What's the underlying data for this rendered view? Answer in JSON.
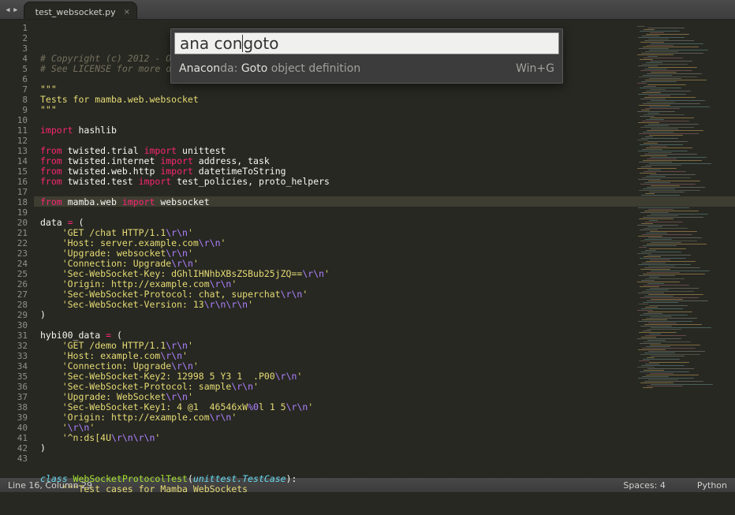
{
  "titlebar": {
    "nav_prev": "◂",
    "nav_next": "▸"
  },
  "tab": {
    "filename": "test_websocket.py",
    "close_glyph": "×"
  },
  "palette": {
    "input_before_cursor": "ana con",
    "input_after_cursor": "goto",
    "result_highlight": "Anacon",
    "result_mid": "da: ",
    "result_highlight2": "Goto",
    "result_tail": " object definition",
    "shortcut": "Win+G"
  },
  "gutter": {
    "start": 1,
    "end": 43
  },
  "code_lines": [
    {
      "t": "plain",
      "text": ""
    },
    {
      "t": "comment",
      "text": "# Copyright (c) 2012 - Osca"
    },
    {
      "t": "comment",
      "text": "# See LICENSE for more deta"
    },
    {
      "t": "plain",
      "text": ""
    },
    {
      "t": "str",
      "text": "\"\"\""
    },
    {
      "t": "str",
      "text": "Tests for mamba.web.websocket"
    },
    {
      "t": "str",
      "text": "\"\"\""
    },
    {
      "t": "plain",
      "text": ""
    },
    {
      "t": "import1",
      "kw": "import ",
      "mod": "hashlib"
    },
    {
      "t": "plain",
      "text": ""
    },
    {
      "t": "import2",
      "kw1": "from ",
      "mod": "twisted.trial",
      "kw2": " import ",
      "names": "unittest"
    },
    {
      "t": "import2",
      "kw1": "from ",
      "mod": "twisted.internet",
      "kw2": " import ",
      "names": "address, task"
    },
    {
      "t": "import2",
      "kw1": "from ",
      "mod": "twisted.web.http",
      "kw2": " import ",
      "names": "datetimeToString"
    },
    {
      "t": "import2",
      "kw1": "from ",
      "mod": "twisted.test",
      "kw2": " import ",
      "names": "test_policies, proto_helpers"
    },
    {
      "t": "plain",
      "text": ""
    },
    {
      "t": "import2",
      "kw1": "from ",
      "mod": "mamba.web",
      "kw2": " import ",
      "names": "websocket"
    },
    {
      "t": "plain",
      "text": ""
    },
    {
      "t": "assign",
      "lhs": "data ",
      "op": "=",
      "rhs": " ("
    },
    {
      "t": "strline",
      "s": "    'GET /chat HTTP/1.1",
      "e": "\\r\\n",
      "tail": "'"
    },
    {
      "t": "strline",
      "s": "    'Host: server.example.com",
      "e": "\\r\\n",
      "tail": "'"
    },
    {
      "t": "strline",
      "s": "    'Upgrade: websocket",
      "e": "\\r\\n",
      "tail": "'"
    },
    {
      "t": "strline",
      "s": "    'Connection: Upgrade",
      "e": "\\r\\n",
      "tail": "'"
    },
    {
      "t": "strline",
      "s": "    'Sec-WebSocket-Key: dGhlIHNhbXBsZSBub25jZQ==",
      "e": "\\r\\n",
      "tail": "'"
    },
    {
      "t": "strline",
      "s": "    'Origin: http://example.com",
      "e": "\\r\\n",
      "tail": "'"
    },
    {
      "t": "strline",
      "s": "    'Sec-WebSocket-Protocol: chat, superchat",
      "e": "\\r\\n",
      "tail": "'"
    },
    {
      "t": "strline",
      "s": "    'Sec-WebSocket-Version: 13",
      "e": "\\r\\n\\r\\n",
      "tail": "'"
    },
    {
      "t": "pl",
      "text": ")"
    },
    {
      "t": "plain",
      "text": ""
    },
    {
      "t": "assign",
      "lhs": "hybi00_data ",
      "op": "=",
      "rhs": " ("
    },
    {
      "t": "strline",
      "s": "    'GET /demo HTTP/1.1",
      "e": "\\r\\n",
      "tail": "'"
    },
    {
      "t": "strline",
      "s": "    'Host: example.com",
      "e": "\\r\\n",
      "tail": "'"
    },
    {
      "t": "strline",
      "s": "    'Connection: Upgrade",
      "e": "\\r\\n",
      "tail": "'"
    },
    {
      "t": "strline",
      "s": "    'Sec-WebSocket-Key2: 12998 5 Y3 1  .P00",
      "e": "\\r\\n",
      "tail": "'"
    },
    {
      "t": "strline",
      "s": "    'Sec-WebSocket-Protocol: sample",
      "e": "\\r\\n",
      "tail": "'"
    },
    {
      "t": "strline",
      "s": "    'Upgrade: WebSocket",
      "e": "\\r\\n",
      "tail": "'"
    },
    {
      "t": "strline2",
      "s": "    'Sec-WebSocket-Key1: 4 @1  46546xW",
      "e1": "%0",
      "s2": "l 1 5",
      "e2": "\\r\\n",
      "tail": "'"
    },
    {
      "t": "strline",
      "s": "    'Origin: http://example.com",
      "e": "\\r\\n",
      "tail": "'"
    },
    {
      "t": "strline",
      "s": "    '",
      "e": "\\r\\n",
      "tail": "'"
    },
    {
      "t": "strline",
      "s": "    '^n:ds[4U",
      "e": "\\r\\n\\r\\n",
      "tail": "'"
    },
    {
      "t": "pl",
      "text": ")"
    },
    {
      "t": "plain",
      "text": ""
    },
    {
      "t": "plain",
      "text": ""
    },
    {
      "t": "classdef",
      "kw": "class ",
      "name": "WebSocketProtocolTest",
      "p1": "(",
      "arg": "unittest.TestCase",
      "p2": "):"
    },
    {
      "t": "str",
      "text": "    \"\"\"Test cases for Mamba WebSockets"
    }
  ],
  "highlight_line_index": 15,
  "status": {
    "left": "Line 16, Column 29",
    "spaces": "Spaces: 4",
    "syntax": "Python"
  }
}
